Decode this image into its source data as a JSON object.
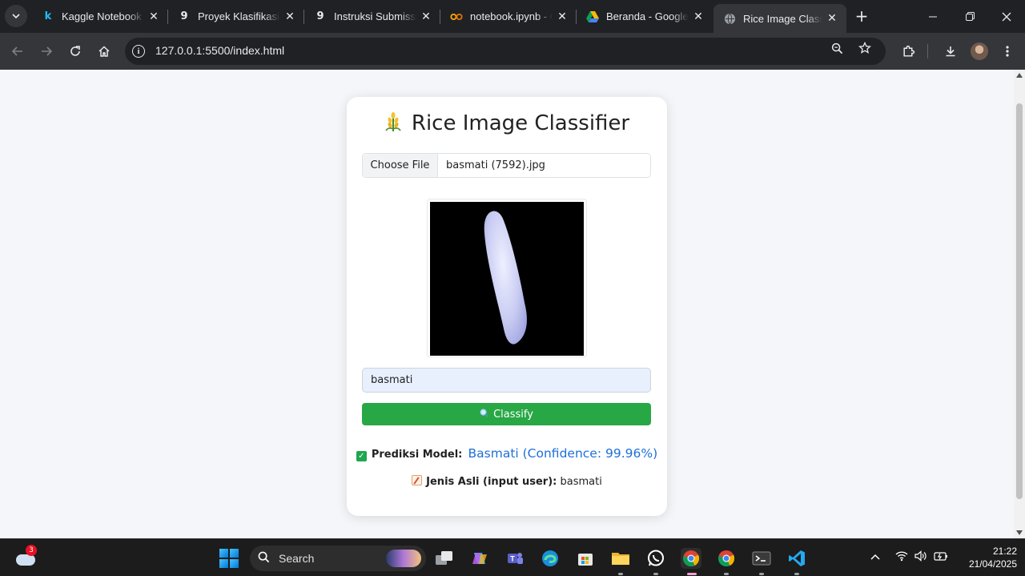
{
  "browser": {
    "tabs": [
      {
        "title": "Kaggle Notebook",
        "favicon": "kaggle-icon",
        "active": false
      },
      {
        "title": "Proyek Klasifikasi Gambar",
        "favicon": "dicoding-icon",
        "active": false
      },
      {
        "title": "Instruksi Submission",
        "favicon": "dicoding-icon",
        "active": false
      },
      {
        "title": "notebook.ipynb - Colab",
        "favicon": "colab-icon",
        "active": false
      },
      {
        "title": "Beranda - Google Drive",
        "favicon": "google-drive-icon",
        "active": false
      },
      {
        "title": "Rice Image Classifier",
        "favicon": "globe-icon",
        "active": true
      }
    ],
    "url": "127.0.0.1:5500/index.html"
  },
  "page": {
    "title": "Rice Image Classifier",
    "logo_icon": "rice-plant-icon",
    "file_button_label": "Choose File",
    "file_name": "basmati (7592).jpg",
    "preview_icon": "rice-grain-image",
    "rice_type_input_value": "basmati",
    "classify_button_label": "Classify",
    "classify_icon": "magnifier-icon",
    "prediction_label": "Prediksi Model:",
    "prediction_value": "Basmati (Confidence: 99.96%)",
    "truth_label": "Jenis Asli (input user):",
    "truth_value": "basmati"
  },
  "colors": {
    "classify_button": "#28a745",
    "prediction_text": "#1e6fd9",
    "page_background": "#f4f6f9"
  },
  "taskbar": {
    "weather_badge": "3",
    "search_label": "Search",
    "time": "21:22",
    "date": "21/04/2025"
  }
}
